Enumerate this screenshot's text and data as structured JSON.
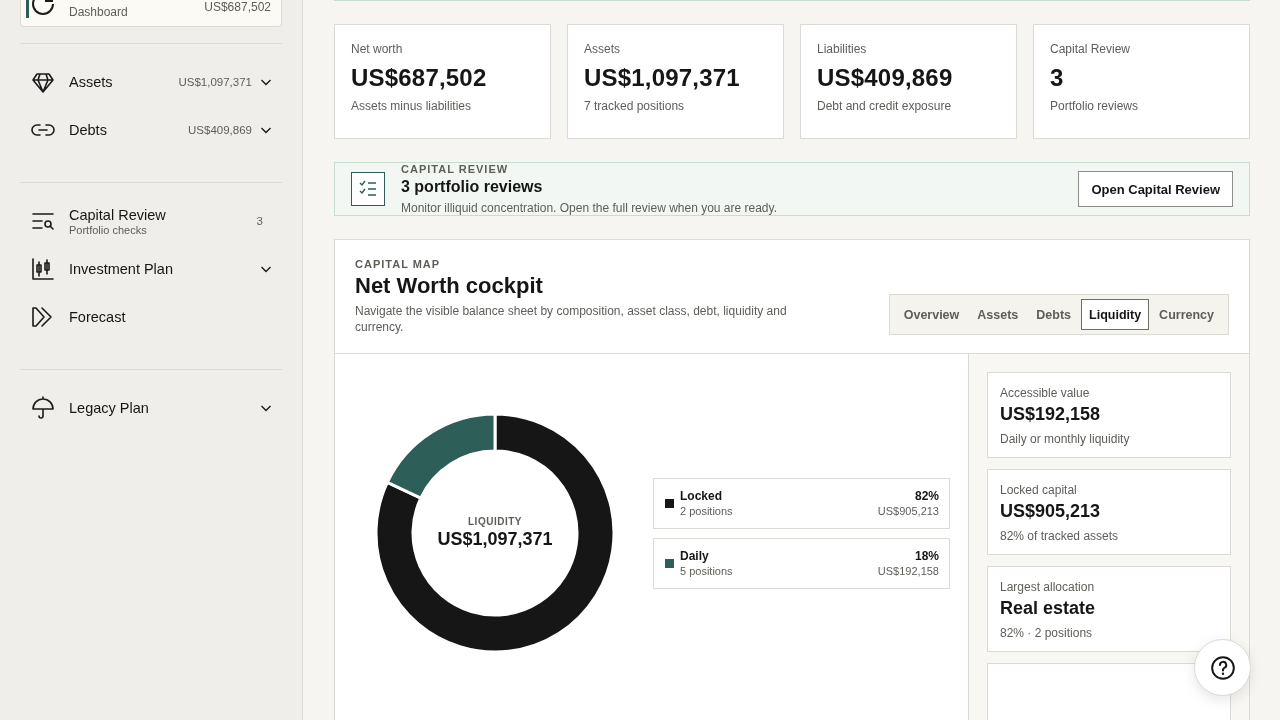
{
  "sidebar": {
    "current": {
      "subtitle": "Dashboard",
      "value": "US$687,502"
    },
    "groups": [
      [
        {
          "kind": "value",
          "label": "Assets",
          "value": "US$1,097,371",
          "expandable": true
        },
        {
          "kind": "value",
          "label": "Debts",
          "value": "US$409,869",
          "expandable": true
        }
      ],
      [
        {
          "kind": "count",
          "label": "Capital Review",
          "subtitle": "Portfolio checks",
          "count": "3",
          "expandable": false
        },
        {
          "kind": "plain",
          "label": "Investment Plan",
          "expandable": true
        },
        {
          "kind": "plain",
          "label": "Forecast",
          "expandable": false
        }
      ],
      [
        {
          "kind": "plain",
          "label": "Legacy Plan",
          "expandable": true
        }
      ]
    ]
  },
  "stats": [
    {
      "label": "Net worth",
      "value": "US$687,502",
      "note": "Assets minus liabilities"
    },
    {
      "label": "Assets",
      "value": "US$1,097,371",
      "note": "7 tracked positions"
    },
    {
      "label": "Liabilities",
      "value": "US$409,869",
      "note": "Debt and credit exposure"
    },
    {
      "label": "Capital Review",
      "value": "3",
      "note": "Portfolio reviews"
    }
  ],
  "review": {
    "eyebrow": "CAPITAL REVIEW",
    "title": "3 portfolio reviews",
    "text": "Monitor illiquid concentration. Open the full review when you are ready.",
    "button": "Open Capital Review"
  },
  "capital_map": {
    "eyebrow": "CAPITAL MAP",
    "title": "Net Worth cockpit",
    "text": "Navigate the visible balance sheet by composition, asset class, debt, liquidity and currency.",
    "tabs": [
      {
        "label": "Overview",
        "selected": false
      },
      {
        "label": "Assets",
        "selected": false
      },
      {
        "label": "Debts",
        "selected": false
      },
      {
        "label": "Liquidity",
        "selected": true
      },
      {
        "label": "Currency",
        "selected": false
      }
    ],
    "center_label": "LIQUIDITY",
    "center_value": "US$1,097,371",
    "chart_data": {
      "type": "donut",
      "categories": [
        "Locked",
        "Daily"
      ],
      "series": [
        {
          "values": [
            82,
            18
          ]
        }
      ]
    },
    "legend": [
      {
        "positions": "2 positions",
        "share": "82%",
        "value": "US$905,213",
        "color": "#161616"
      },
      {
        "positions": "5 positions",
        "share": "18%",
        "value": "US$192,158",
        "color": "#2e5e58"
      }
    ],
    "insights": [
      {
        "label": "Accessible value",
        "value": "US$192,158",
        "note": "Daily or monthly liquidity"
      },
      {
        "label": "Locked capital",
        "value": "US$905,213",
        "note": "82% of tracked assets"
      },
      {
        "label": "Largest allocation",
        "value": "Real estate",
        "note": "82% · 2 positions"
      }
    ]
  }
}
